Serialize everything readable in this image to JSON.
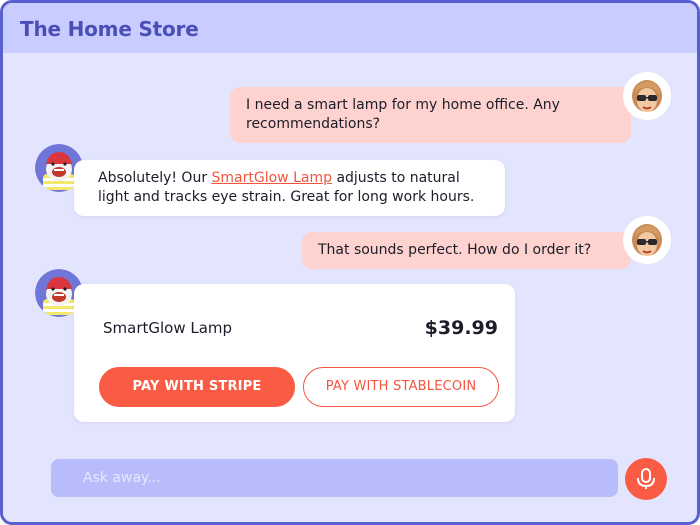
{
  "header": {
    "title": "The Home Store"
  },
  "messages": [
    {
      "role": "user",
      "text": "I need a smart lamp for my home office. Any recommendations?"
    },
    {
      "role": "bot",
      "before": "Absolutely! Our ",
      "link": "SmartGlow Lamp",
      "after": " adjusts to natural light and tracks eye strain. Great for long work hours."
    },
    {
      "role": "user",
      "text": "That sounds perfect. How do I order it?"
    }
  ],
  "product_card": {
    "name": "SmartGlow Lamp",
    "price": "$39.99",
    "pay_stripe_label": "PAY WITH STRIPE",
    "pay_stablecoin_label": "PAY WITH STABLECOIN"
  },
  "input": {
    "placeholder": "Ask away..."
  },
  "colors": {
    "accent": "#f95b45",
    "header_bg": "#c9ccff",
    "chat_bg": "#e3e5ff",
    "user_bubble": "#fdd2cf",
    "brand_text": "#4a4fb8"
  },
  "icons": {
    "user_avatar": "user-avatar-icon",
    "bot_avatar": "bot-avatar-icon",
    "mic": "microphone-icon"
  }
}
